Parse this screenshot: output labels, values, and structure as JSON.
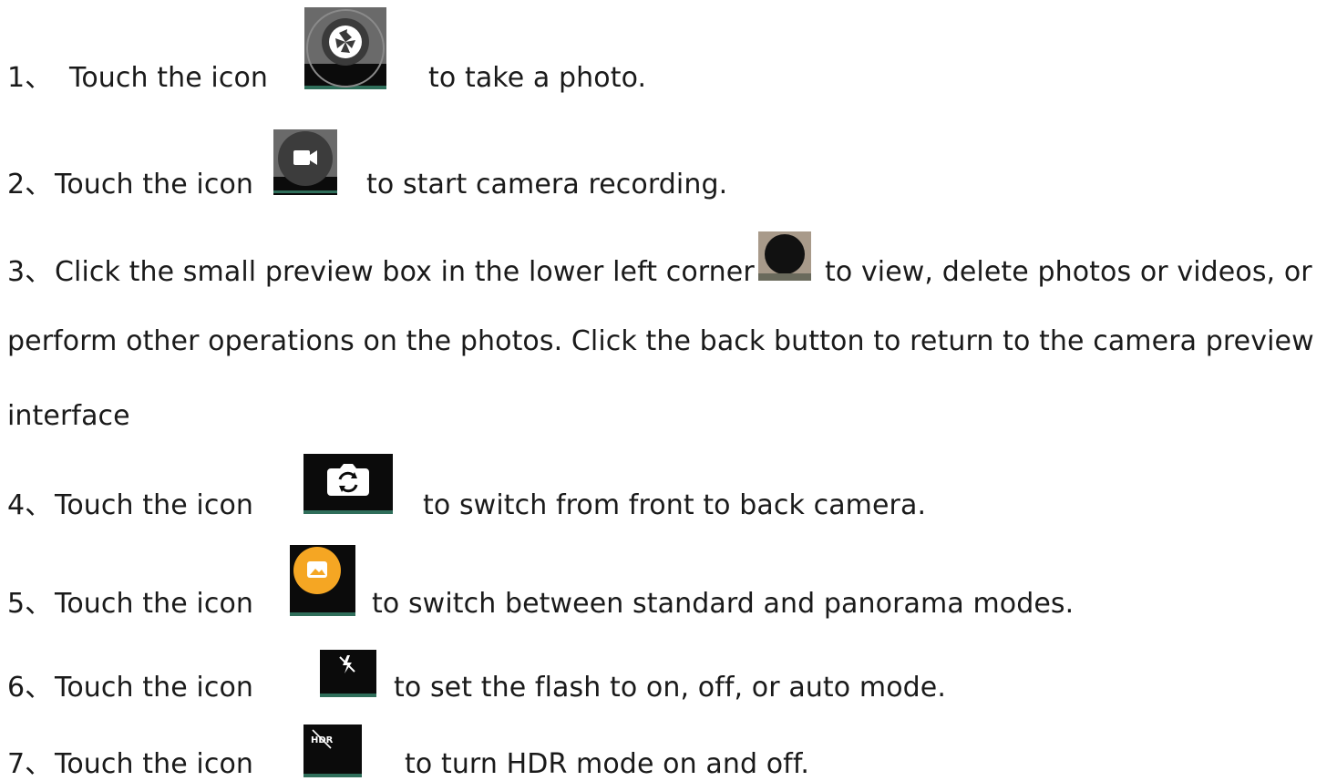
{
  "steps": [
    {
      "num": "1、",
      "lead": "Touch the icon",
      "icon": "shutter-icon",
      "tail": "to take a photo."
    },
    {
      "num": "2、",
      "lead": "Touch the icon",
      "icon": "video-camera-icon",
      "tail": "to start camera recording."
    },
    {
      "num": "3、",
      "lead": "Click the small preview box in the lower left corner",
      "icon": "preview-thumbnail-icon",
      "tail": "to view, delete photos or videos, or",
      "cont1": "perform other operations on the photos. Click the back button to return to the camera preview",
      "cont2": "interface"
    },
    {
      "num": "4、",
      "lead": "Touch the icon",
      "icon": "switch-camera-icon",
      "tail": "to switch from front to back camera."
    },
    {
      "num": "5、",
      "lead": "Touch the icon",
      "icon": "panorama-mode-icon",
      "tail": "to switch between standard and panorama modes."
    },
    {
      "num": "6、",
      "lead": "Touch the icon",
      "icon": "flash-off-icon",
      "tail": "to set the flash to on, off, or auto mode."
    },
    {
      "num": "7、",
      "lead": "Touch the icon",
      "icon": "hdr-off-icon",
      "tail": "to turn HDR mode on and off.",
      "icon_text": "HDR"
    }
  ],
  "colors": {
    "text": "#1a1a1a",
    "icon_bg": "#6e6e6e",
    "accent_orange": "#f5a623",
    "underline": "#2f6e5a"
  }
}
